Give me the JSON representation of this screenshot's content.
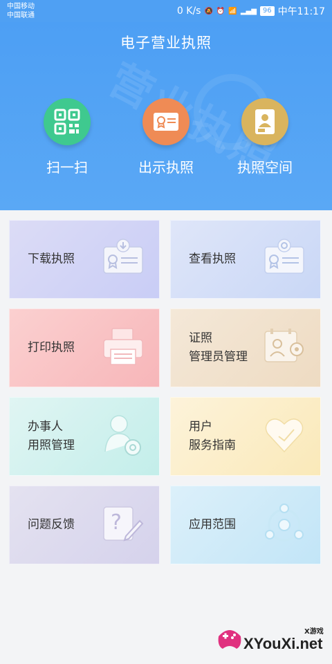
{
  "status": {
    "carrier1": "中国移动",
    "carrier2": "中国联通",
    "speed": "0 K/s",
    "battery": "96",
    "time": "中午11:17"
  },
  "header": {
    "title": "电子营业执照",
    "watermark": "营业执照"
  },
  "quick_actions": [
    {
      "label": "扫一扫",
      "icon": "qr-code-icon",
      "color": "#3fc98f"
    },
    {
      "label": "出示执照",
      "icon": "license-card-icon",
      "color": "#ef8b55"
    },
    {
      "label": "执照空间",
      "icon": "license-space-icon",
      "color": "#d9b45e"
    }
  ],
  "tiles": [
    {
      "line1": "下载执照",
      "line2": "",
      "icon": "download-license-icon"
    },
    {
      "line1": "查看执照",
      "line2": "",
      "icon": "view-license-icon"
    },
    {
      "line1": "打印执照",
      "line2": "",
      "icon": "printer-icon"
    },
    {
      "line1": "证照",
      "line2": "管理员管理",
      "icon": "admin-manage-icon"
    },
    {
      "line1": "办事人",
      "line2": "用照管理",
      "icon": "agent-manage-icon"
    },
    {
      "line1": "用户",
      "line2": "服务指南",
      "icon": "heart-icon"
    },
    {
      "line1": "问题反馈",
      "line2": "",
      "icon": "feedback-icon"
    },
    {
      "line1": "应用范围",
      "line2": "",
      "icon": "scope-icon"
    }
  ],
  "watermark_logo": {
    "brand": "XYouXi.net",
    "small": "X游戏"
  }
}
